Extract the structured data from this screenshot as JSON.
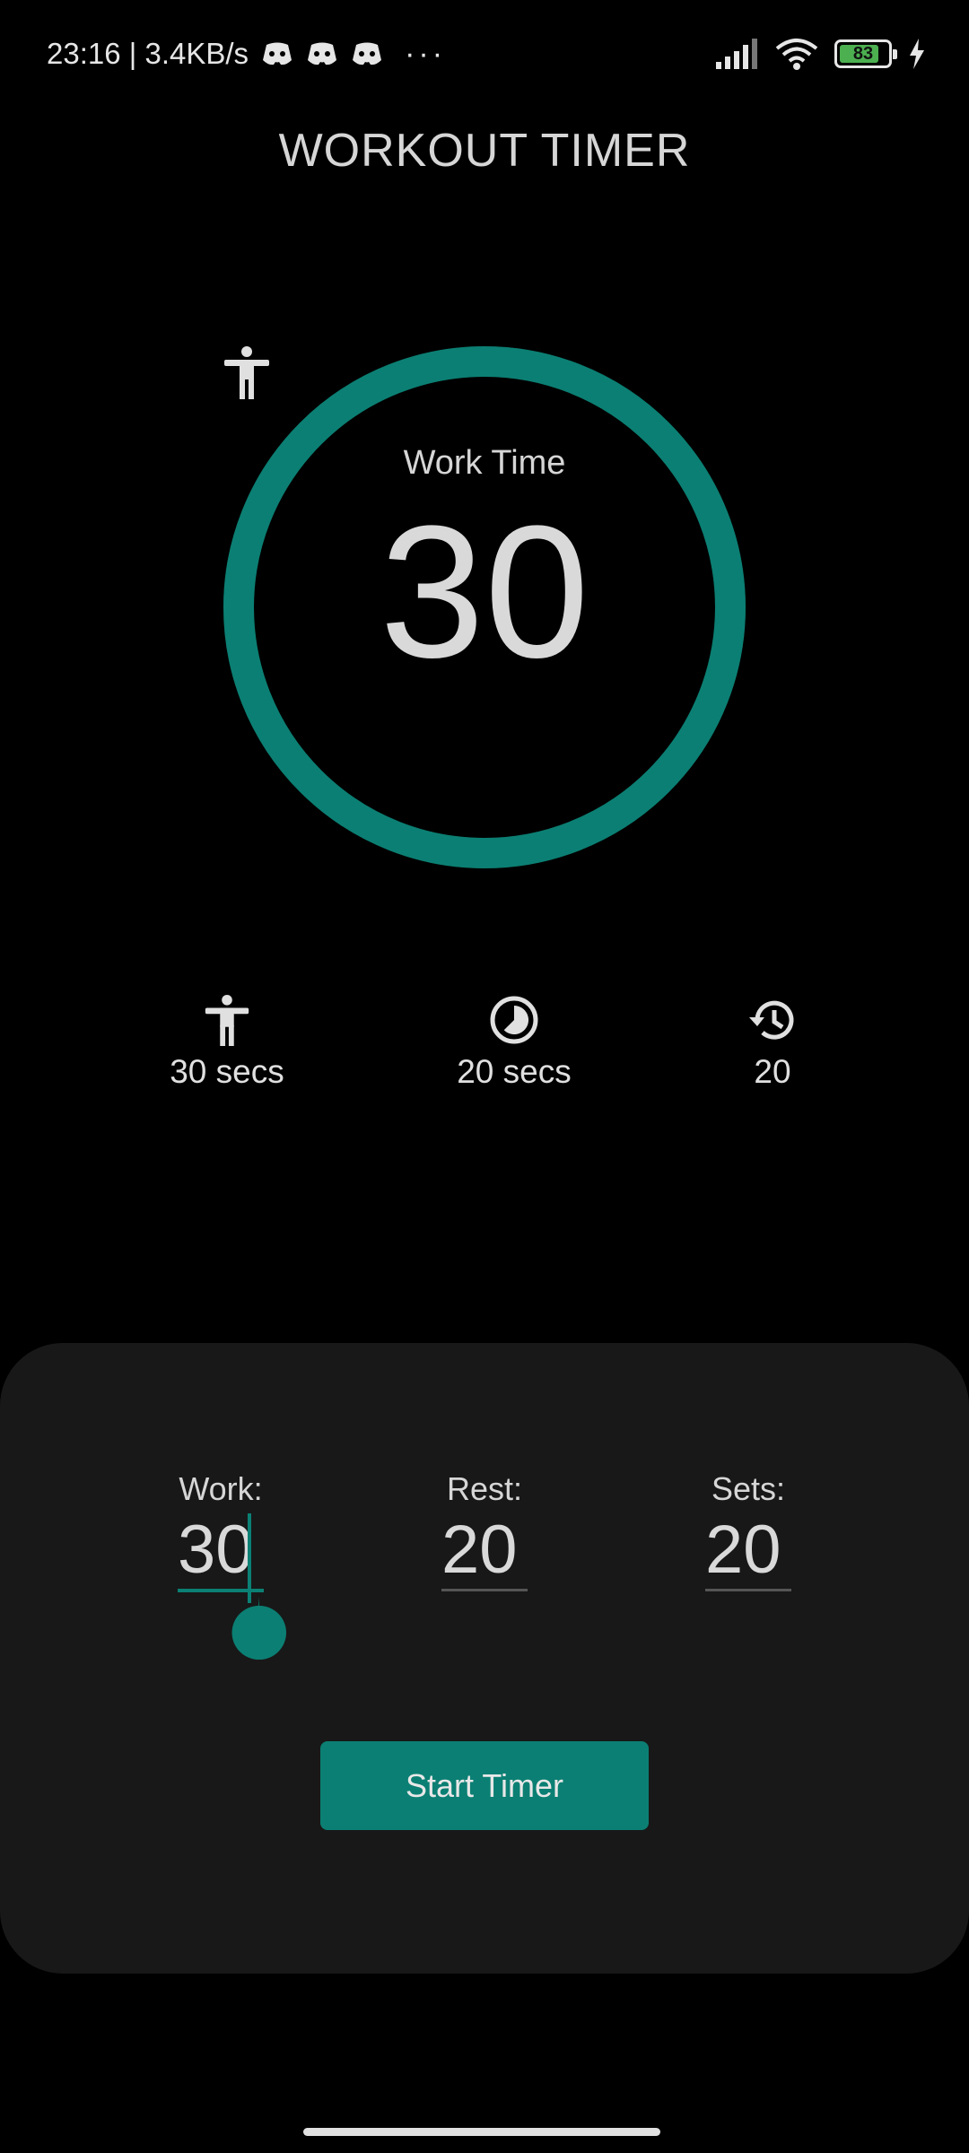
{
  "status_bar": {
    "time_speed": "23:16 | 3.4KB/s",
    "more": "···",
    "battery_level": "83",
    "battery_fraction": 0.83
  },
  "title": "WORKOUT TIMER",
  "ring": {
    "label": "Work Time",
    "value": "30",
    "progress_fraction": 1.0,
    "color": "#0b7f73"
  },
  "stats": {
    "work": "30 secs",
    "rest": "20 secs",
    "sets": "20"
  },
  "form": {
    "work_label": "Work:",
    "work_value": "30",
    "rest_label": "Rest:",
    "rest_value": "20",
    "sets_label": "Sets:",
    "sets_value": "20"
  },
  "start_button": "Start Timer",
  "accent_color": "#0b7f73"
}
